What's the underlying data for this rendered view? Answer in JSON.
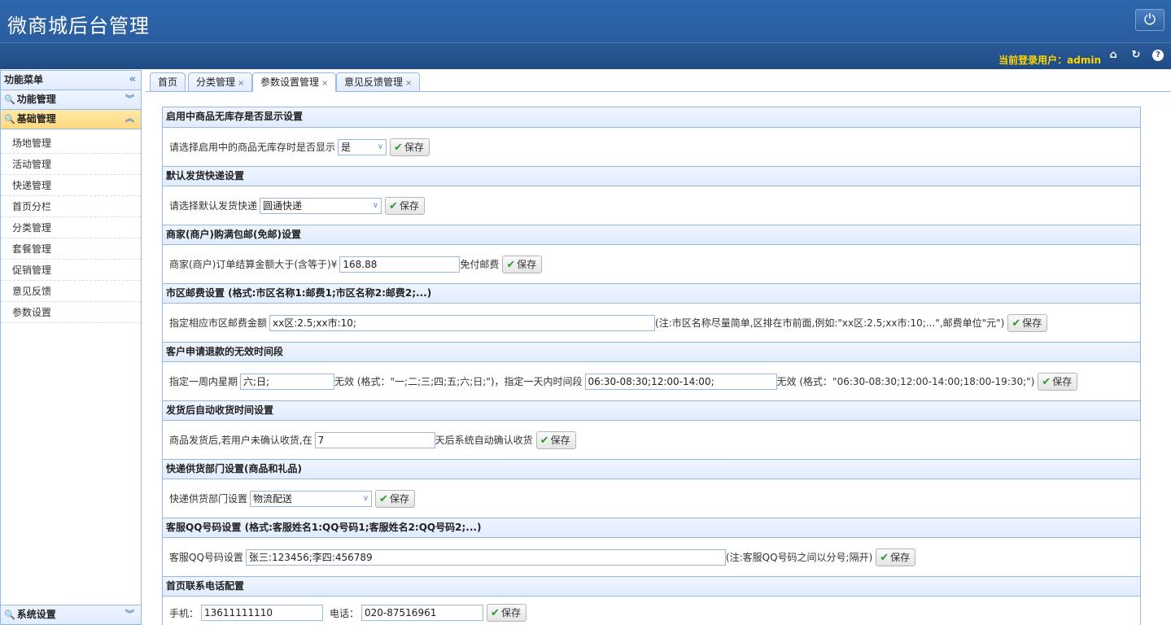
{
  "app": {
    "title": "微商城后台管理"
  },
  "userbar": {
    "current_user": "当前登录用户：admin"
  },
  "sidebar": {
    "title": "功能菜单",
    "groups": [
      {
        "label": "功能管理"
      },
      {
        "label": "基础管理"
      },
      {
        "label": "系统设置"
      }
    ],
    "items": [
      "场地管理",
      "活动管理",
      "快递管理",
      "首页分栏",
      "分类管理",
      "套餐管理",
      "促销管理",
      "意见反馈",
      "参数设置"
    ]
  },
  "tabs": [
    {
      "label": "首页"
    },
    {
      "label": "分类管理"
    },
    {
      "label": "参数设置管理"
    },
    {
      "label": "意见反馈管理"
    }
  ],
  "save_label": "保存",
  "sections": {
    "s1": {
      "title": "启用中商品无库存是否显示设置",
      "label": "请选择启用中的商品无库存时是否显示",
      "value": "是"
    },
    "s2": {
      "title": "默认发货快递设置",
      "label": "请选择默认发货快递",
      "value": "圆通快递"
    },
    "s3": {
      "title": "商家(商户)购满包邮(免邮)设置",
      "label": "商家(商户)订单结算金额大于(含等于)¥",
      "value": "168.88",
      "suffix": "免付邮费"
    },
    "s4": {
      "title": "市区邮费设置 (格式:市区名称1:邮费1;市区名称2:邮费2;...)",
      "label": "指定相应市区邮费金额",
      "value": "xx区:2.5;xx市:10;",
      "note": "(注:市区名称尽量简单,区排在市前面,例如:\"xx区:2.5;xx市:10;...\",邮费单位\"元\")"
    },
    "s5": {
      "title": "客户申请退款的无效时间段",
      "label1": "指定一周内星期",
      "value1": "六;日;",
      "mid": "无效 (格式：\"一;二;三;四;五;六;日;\")，指定一天内时间段",
      "value2": "06:30-08:30;12:00-14:00;",
      "tail": "无效 (格式：\"06:30-08:30;12:00-14:00;18:00-19:30;\")"
    },
    "s6": {
      "title": "发货后自动收货时间设置",
      "label": "商品发货后,若用户未确认收货,在",
      "value": "7",
      "suffix": "天后系统自动确认收货"
    },
    "s7": {
      "title": "快递供货部门设置(商品和礼品)",
      "label": "快递供货部门设置",
      "value": "物流配送"
    },
    "s8": {
      "title": "客服QQ号码设置 (格式:客服姓名1:QQ号码1;客服姓名2:QQ号码2;...)",
      "label": "客服QQ号码设置",
      "value": "张三:123456;李四:456789",
      "note": "(注:客服QQ号码之间以分号;隔开)"
    },
    "s9": {
      "title": "首页联系电话配置",
      "label1": "手机：",
      "value1": "13611111110",
      "label2": "电话：",
      "value2": "020-87516961"
    }
  }
}
